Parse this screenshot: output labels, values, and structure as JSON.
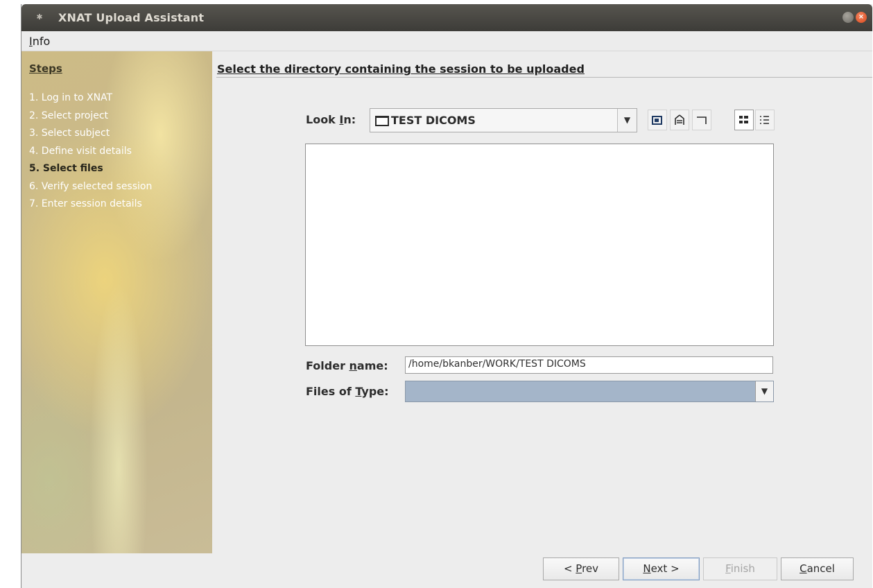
{
  "window": {
    "title": "XNAT Upload Assistant"
  },
  "menu": {
    "items": [
      {
        "mnemonic": "I",
        "rest": "nfo"
      }
    ]
  },
  "steps": {
    "header": "Steps",
    "items": [
      "1. Log in to XNAT",
      "2. Select project",
      "3. Select subject",
      "4. Define visit details",
      "5. Select files",
      "6. Verify selected session",
      "7. Enter session details"
    ],
    "current_index": 4
  },
  "content": {
    "header": "Select the directory containing the session to be uploaded"
  },
  "chooser": {
    "look_in_label_pre": "Look ",
    "look_in_label_mn": "I",
    "look_in_label_post": "n:",
    "look_in_value": "TEST DICOMS",
    "folder_name_label_pre": "Folder ",
    "folder_name_label_mn": "n",
    "folder_name_label_post": "ame:",
    "folder_name_value": "/home/bkanber/WORK/TEST DICOMS",
    "files_of_type_label_pre": "Files of ",
    "files_of_type_label_mn": "T",
    "files_of_type_label_post": "ype:",
    "files_of_type_value": "",
    "toolbar": [
      "up-one-level-icon",
      "home-icon",
      "new-folder-icon",
      "list-view-icon",
      "details-view-icon"
    ]
  },
  "buttons": {
    "prev": {
      "pre": "< ",
      "mn": "P",
      "post": "rev"
    },
    "next": {
      "mn": "N",
      "post": "ext >"
    },
    "finish": {
      "mn": "F",
      "post": "inish"
    },
    "cancel": {
      "mn": "C",
      "post": "ancel"
    }
  }
}
